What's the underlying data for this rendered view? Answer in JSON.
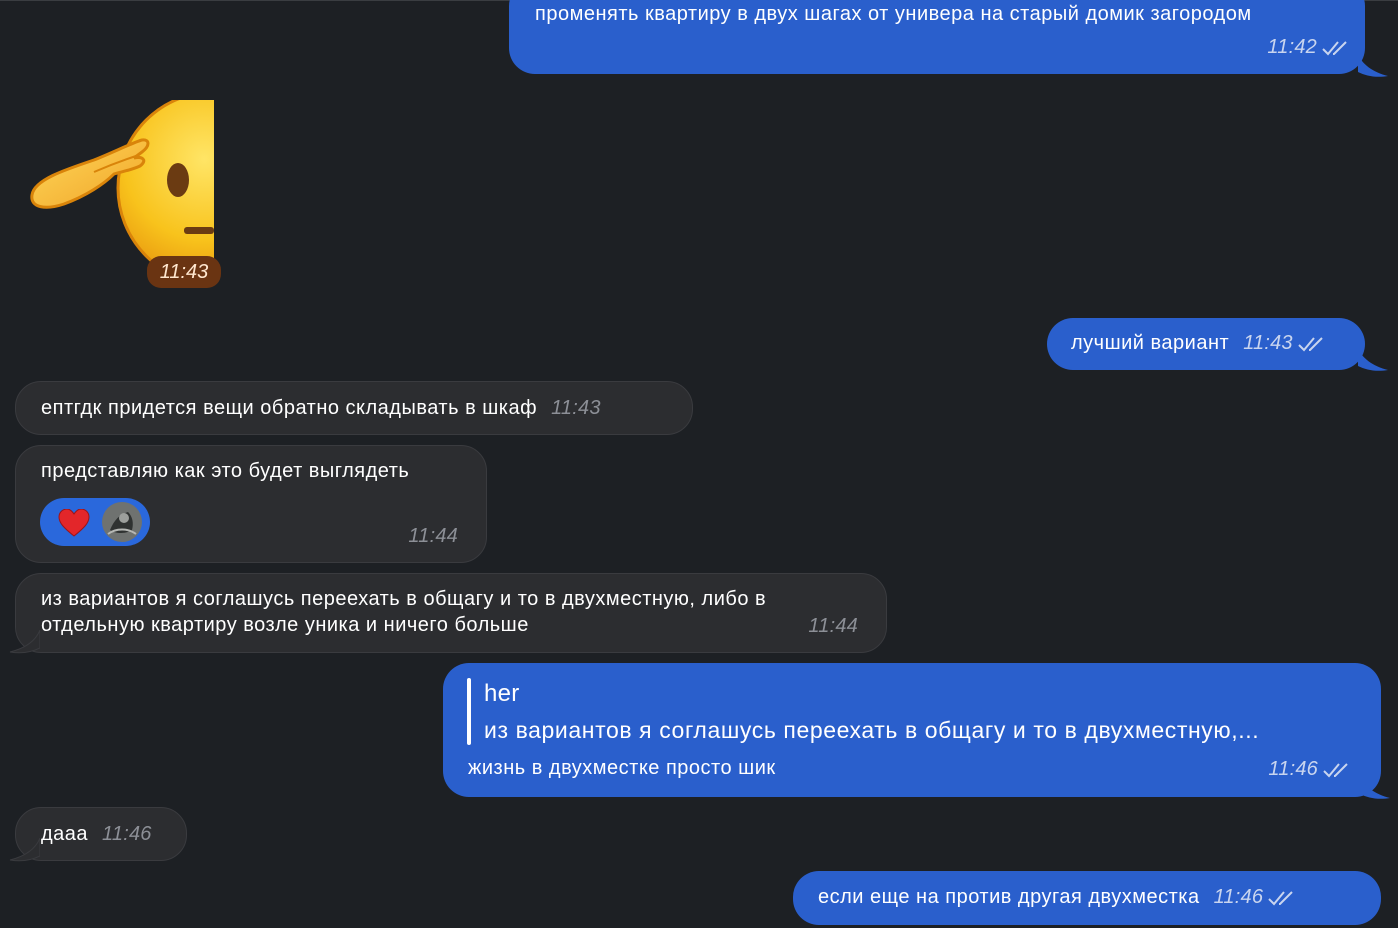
{
  "messages": [
    {
      "id": "m1",
      "dir": "out",
      "text": "променять квартиру в двух шагах от универа на старый домик загородом",
      "time": "11:42"
    },
    {
      "id": "m2",
      "dir": "in",
      "type": "sticker",
      "sticker": "saluting-face-emoji",
      "time": "11:43"
    },
    {
      "id": "m3",
      "dir": "out",
      "text": "лучший вариант",
      "time": "11:43"
    },
    {
      "id": "m4",
      "dir": "in",
      "text": "ептгдк придется вещи обратно складывать в шкаф",
      "time": "11:43"
    },
    {
      "id": "m5",
      "dir": "in",
      "text": "представляю как это будет выглядеть",
      "time": "11:44",
      "reactions": [
        {
          "emoji": "❤️"
        },
        {
          "avatar": "reactor-avatar"
        }
      ]
    },
    {
      "id": "m6",
      "dir": "in",
      "line1": "из вариантов я соглашусь переехать в общагу и то в двухместную, либо в",
      "line2": "отдельную квартиру возле уника и ничего больше",
      "time": "11:44"
    },
    {
      "id": "m7",
      "dir": "out",
      "reply": {
        "author": "her",
        "quote": "из вариантов я соглашусь переехать в общагу и то в двухместную,..."
      },
      "text": "жизнь в двухместке просто шик",
      "time": "11:46"
    },
    {
      "id": "m8",
      "dir": "in",
      "text": "дааа",
      "time": "11:46"
    },
    {
      "id": "m9",
      "dir": "out",
      "text": "если еще на против другая двухместка",
      "time": "11:46"
    }
  ],
  "colors": {
    "background": "#1d2024",
    "outgoing": "#2a5fcc",
    "incoming": "#2c2d30",
    "sticker_time_bg": "#6a3412"
  },
  "icons": {
    "read_receipt": "double-check-icon"
  }
}
